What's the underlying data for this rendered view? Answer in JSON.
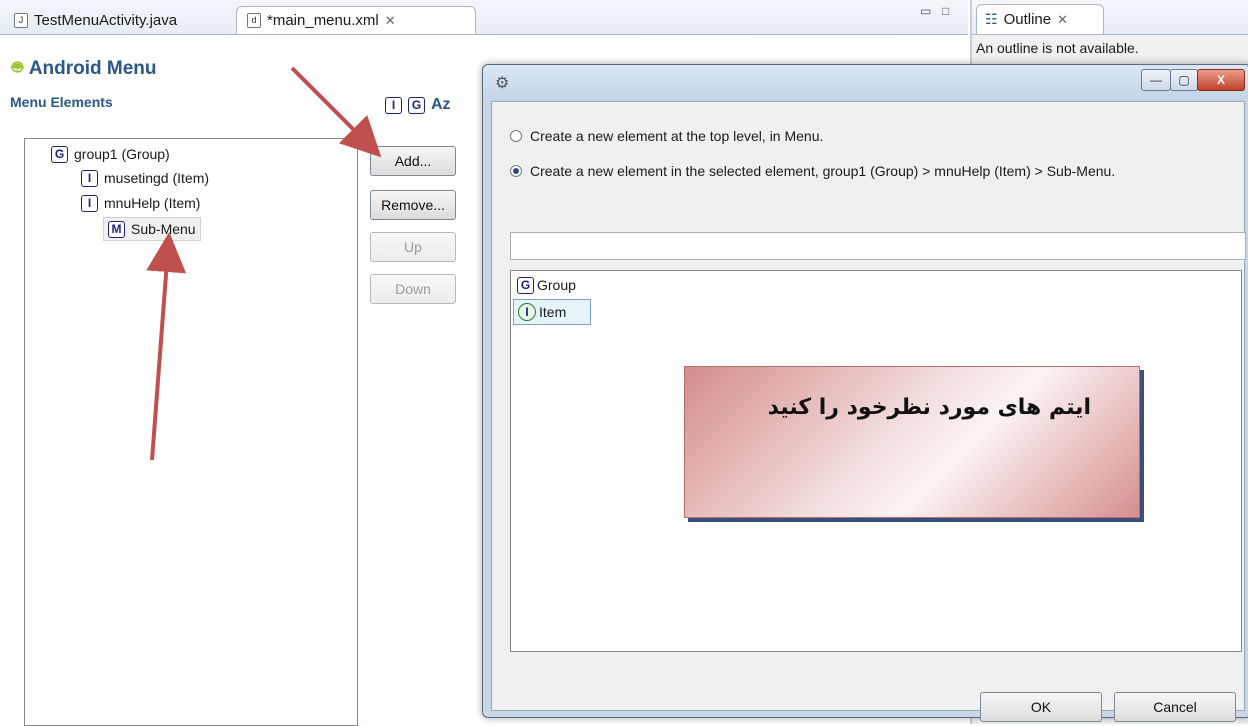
{
  "editor_tabs": [
    {
      "label": "TestMenuActivity.java",
      "icon": "java-file-icon"
    },
    {
      "label": "*main_menu.xml",
      "icon": "xml-file-icon"
    }
  ],
  "outline": {
    "tab_label": "Outline",
    "message": "An outline is not available."
  },
  "editor": {
    "title": "Android Menu",
    "section_label": "Menu Elements",
    "sort_icons": [
      "I",
      "G",
      "Az"
    ],
    "tree": [
      {
        "badge": "G",
        "label": "group1 (Group)"
      },
      {
        "badge": "I",
        "label": "musetingd (Item)"
      },
      {
        "badge": "I",
        "label": "mnuHelp (Item)"
      },
      {
        "badge": "M",
        "label": "Sub-Menu"
      }
    ],
    "buttons": {
      "add": "Add...",
      "remove": "Remove...",
      "up": "Up",
      "down": "Down"
    }
  },
  "dialog": {
    "title": "",
    "option_top": "Create a new element at the top level, in Menu.",
    "option_selected": "Create a new element in the selected element, group1 (Group) > mnuHelp (Item) > Sub-Menu.",
    "filter_value": "",
    "types": [
      {
        "badge": "G",
        "label": "Group"
      },
      {
        "badge": "I",
        "label": "Item"
      }
    ],
    "ok": "OK",
    "cancel": "Cancel",
    "win_buttons": {
      "minimize": "—",
      "maximize": "▢",
      "close": "X"
    }
  },
  "annotation": {
    "note": "ایتم های مورد نظرخود را کنید"
  },
  "colors": {
    "title_blue": "#2a5788",
    "arrow_red": "#c0504d",
    "note_shadow": "#3b4e7e"
  }
}
